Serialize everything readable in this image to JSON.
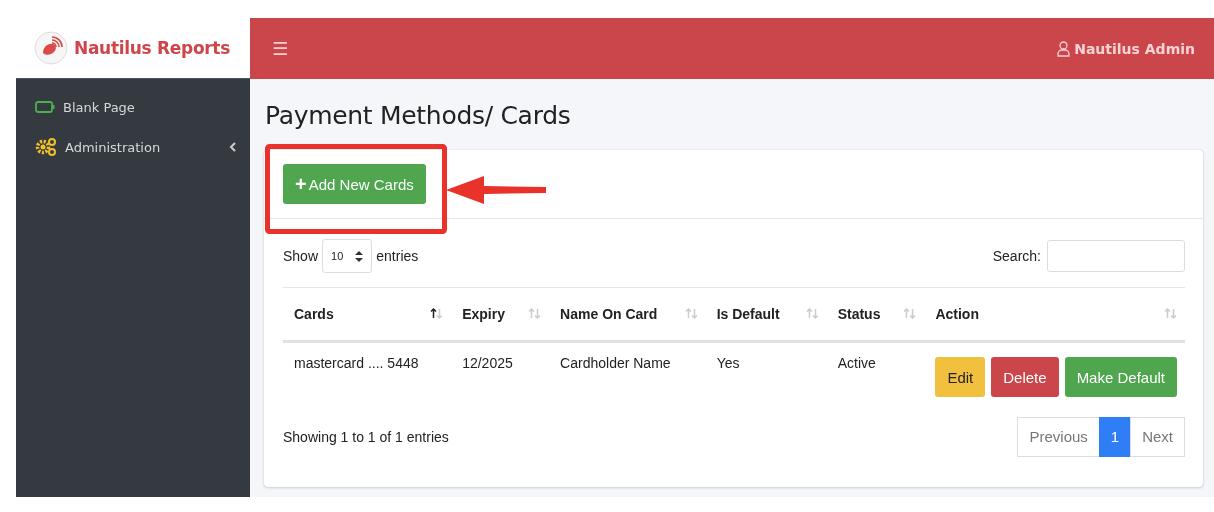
{
  "brand": {
    "name": "Nautilus Reports"
  },
  "topbar": {
    "menu_icon": "☰",
    "user": "Nautilus Admin"
  },
  "sidebar": {
    "items": [
      {
        "label": "Blank Page",
        "has_submenu": false
      },
      {
        "label": "Administration",
        "has_submenu": true
      }
    ]
  },
  "page_title": "Payment Methods/ Cards",
  "add_button": {
    "icon": "+",
    "label": "Add New Cards"
  },
  "length_control": {
    "before": "Show",
    "value": "10",
    "after": "entries"
  },
  "search": {
    "label": "Search:"
  },
  "table": {
    "columns": [
      {
        "label": "Cards",
        "sorted": true
      },
      {
        "label": "Expiry",
        "sorted": false
      },
      {
        "label": "Name On Card",
        "sorted": false
      },
      {
        "label": "Is Default",
        "sorted": false
      },
      {
        "label": "Status",
        "sorted": false
      },
      {
        "label": "Action",
        "sorted": false
      }
    ],
    "rows": [
      {
        "cells": [
          "mastercard .... 5448",
          "12/2025",
          "Cardholder Name",
          "Yes",
          "Active"
        ],
        "actions": [
          {
            "label": "Edit",
            "kind": "warning"
          },
          {
            "label": "Delete",
            "kind": "danger"
          },
          {
            "label": "Make Default",
            "kind": "success"
          }
        ]
      }
    ]
  },
  "info": "Showing 1 to 1 of 1 entries",
  "pagination": [
    {
      "label": "Previous",
      "selected": false
    },
    {
      "label": "1",
      "selected": true
    },
    {
      "label": "Next",
      "selected": false
    }
  ]
}
